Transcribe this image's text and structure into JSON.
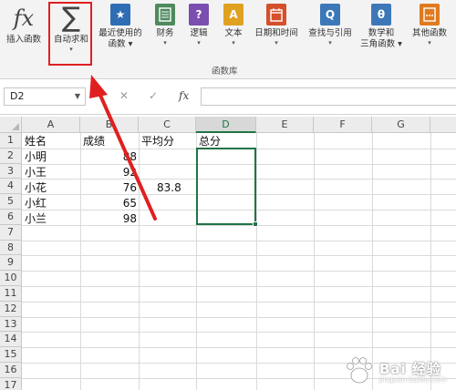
{
  "ribbon": {
    "buttons": [
      {
        "label": "插入函数",
        "icon": "fx-icon",
        "caret": ""
      },
      {
        "label": "自动求和",
        "icon": "sigma-icon",
        "caret": "▾"
      },
      {
        "label": "最近使用的",
        "label2": "函数 ▾",
        "icon": "star-icon"
      },
      {
        "label": "财务",
        "caret": "▾",
        "icon": "finance-icon"
      },
      {
        "label": "逻辑",
        "caret": "▾",
        "icon": "logic-icon"
      },
      {
        "label": "文本",
        "caret": "▾",
        "icon": "text-icon"
      },
      {
        "label": "日期和时间",
        "caret": "▾",
        "icon": "calendar-icon"
      },
      {
        "label": "查找与引用",
        "caret": "▾",
        "icon": "lookup-icon"
      },
      {
        "label": "数学和",
        "label2": "三角函数 ▾",
        "icon": "theta-icon"
      },
      {
        "label": "其他函数",
        "caret": "▾",
        "icon": "more-functions-icon"
      }
    ],
    "icon_glyphs": {
      "fx": "fx",
      "sigma": "∑",
      "star": "★",
      "logic": "?",
      "text": "A",
      "lookup": "Q",
      "theta": "θ"
    },
    "group_label": "函数库",
    "colors": {
      "star": "#2e6db4",
      "finance": "#4e8a5e",
      "logic": "#7a4fb0",
      "text": "#e0a020",
      "calendar": "#d4502c",
      "lookup": "#3c78b8",
      "theta": "#3c78b8",
      "more": "#e07a20"
    }
  },
  "formula_bar": {
    "name_box": "D2",
    "cancel_symbol": "✕",
    "confirm_symbol": "✓",
    "fx_label": "fx",
    "formula_value": ""
  },
  "grid": {
    "columns": [
      "A",
      "B",
      "C",
      "D",
      "E",
      "F",
      "G"
    ],
    "selected_column": "D",
    "rows": [
      "1",
      "2",
      "3",
      "4",
      "5",
      "6",
      "7",
      "8",
      "9",
      "10",
      "11",
      "12",
      "13",
      "14",
      "15",
      "16",
      "17"
    ],
    "cells": {
      "A1": "姓名",
      "B1": "成绩",
      "C1": "平均分",
      "D1": "总分",
      "A2": "小明",
      "B2": "88",
      "A3": "小王",
      "B3": "92",
      "A4": "小花",
      "B4": "76",
      "C4": "83.8",
      "A5": "小红",
      "B5": "65",
      "A6": "小兰",
      "B6": "98"
    },
    "selection": "D2:D6",
    "accent": "#217346"
  },
  "annotation": {
    "color": "#e02020"
  },
  "watermark": {
    "text": "Bai 经验",
    "url": "jingyan.baidu.com"
  }
}
